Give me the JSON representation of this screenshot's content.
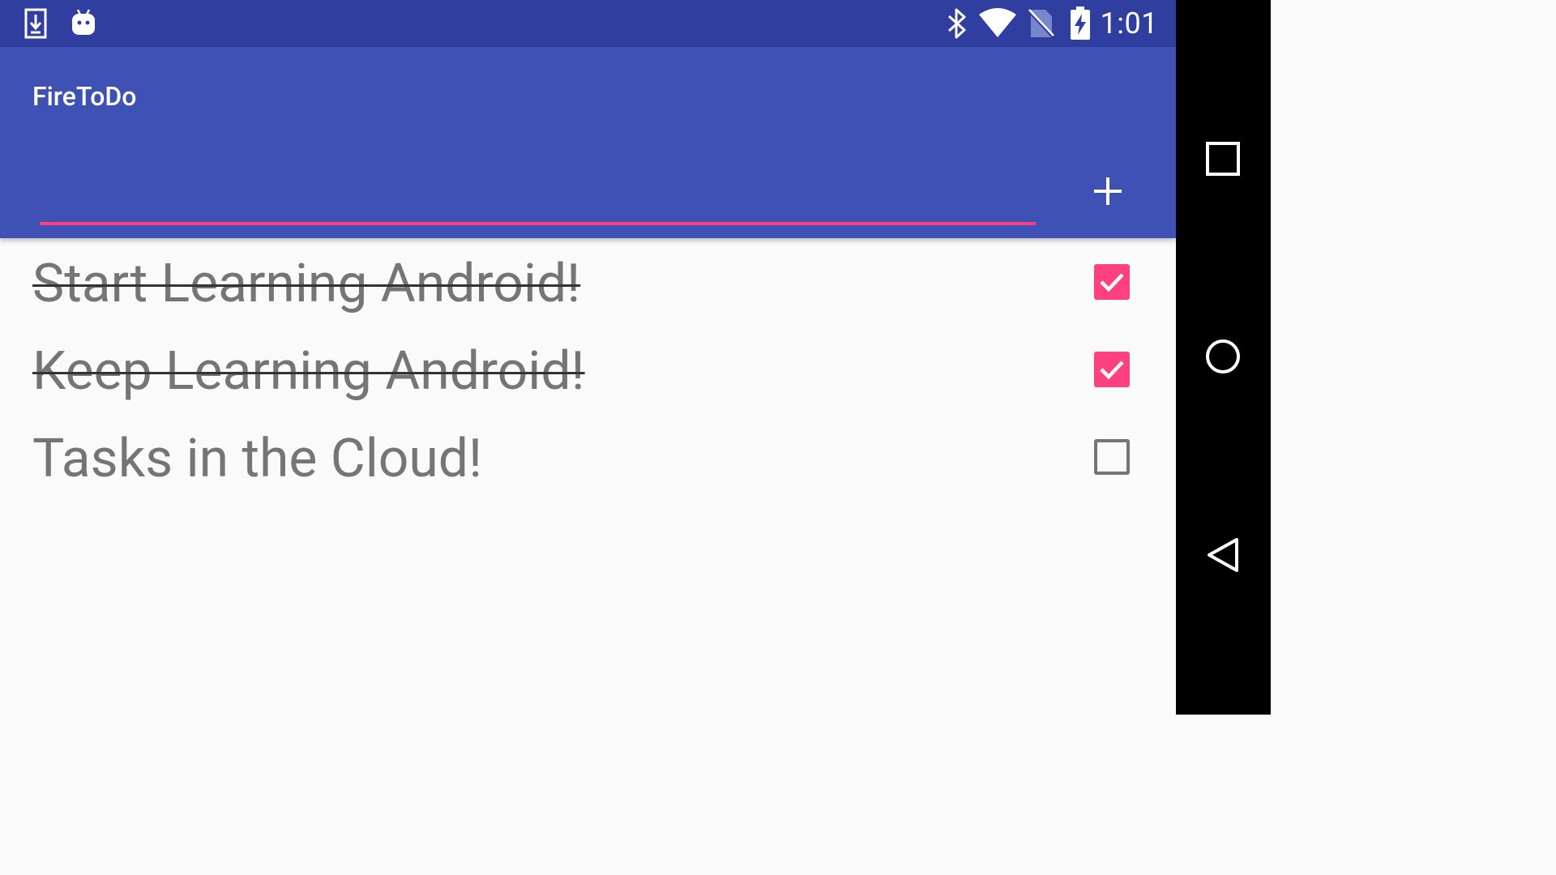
{
  "status_bar": {
    "time": "1:01",
    "icons": [
      "download-notification-icon",
      "android-notification-icon",
      "bluetooth-icon",
      "wifi-icon",
      "no-sim-icon",
      "battery-charging-icon"
    ]
  },
  "app_bar": {
    "title": "FireToDo",
    "input_value": "",
    "add_icon": "plus-icon"
  },
  "tasks": [
    {
      "label": "Start Learning Android!",
      "done": true
    },
    {
      "label": "Keep Learning Android!",
      "done": true
    },
    {
      "label": "Tasks in the Cloud!",
      "done": false
    }
  ],
  "nav_bar": {
    "buttons": [
      "recents-icon",
      "home-icon",
      "back-icon"
    ]
  },
  "colors": {
    "status_bar": "#303f9f",
    "primary": "#3f51b5",
    "accent": "#ff4081",
    "text_secondary": "#757575",
    "background": "#fafafa"
  }
}
